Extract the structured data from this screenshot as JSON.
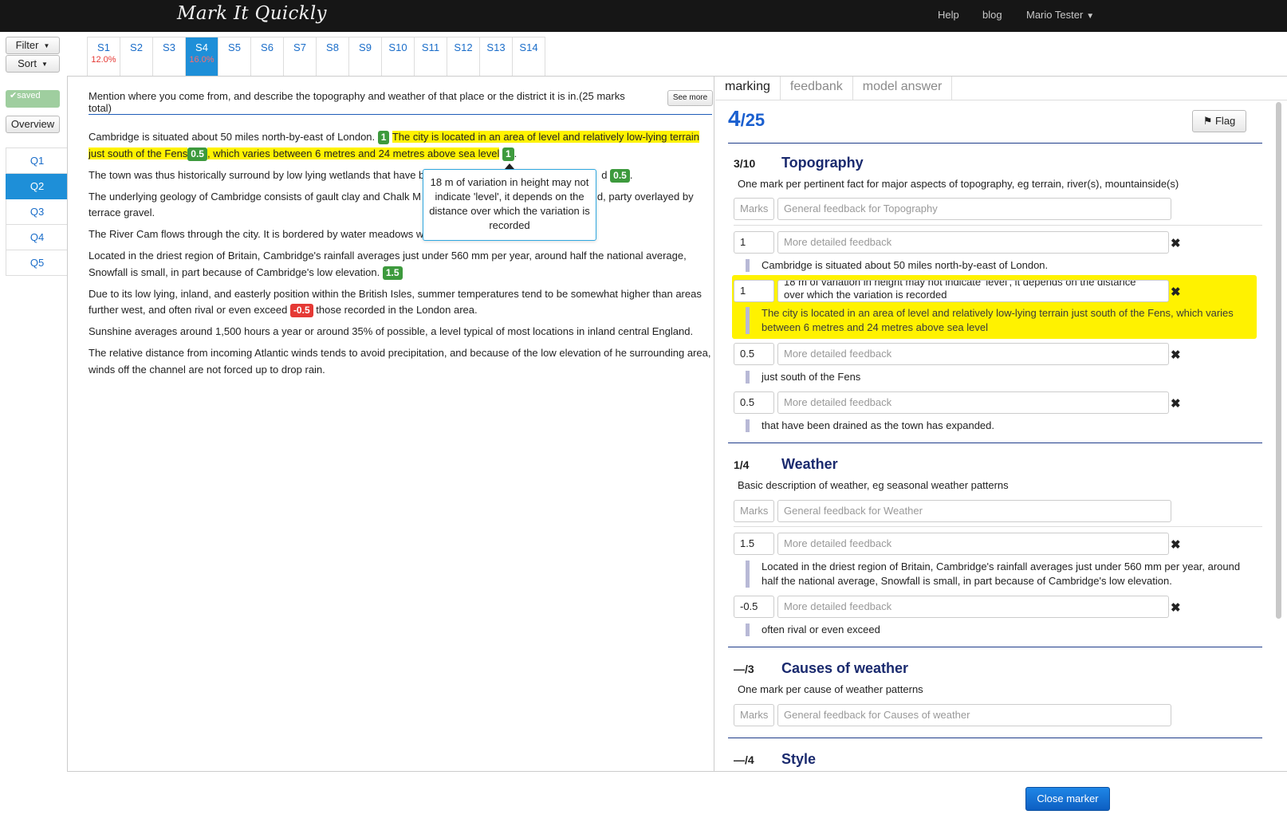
{
  "navbar": {
    "brand": "Mark It Quickly",
    "help": "Help",
    "blog": "blog",
    "user": "Mario Tester"
  },
  "controls": {
    "filter": "Filter",
    "sort": "Sort",
    "saved": "saved",
    "overview": "Overview"
  },
  "questions": [
    "Q1",
    "Q2",
    "Q3",
    "Q4",
    "Q5"
  ],
  "students": [
    {
      "label": "S1",
      "pct": "12.0%"
    },
    {
      "label": "S2",
      "pct": ""
    },
    {
      "label": "S3",
      "pct": ""
    },
    {
      "label": "S4",
      "pct": "16.0%"
    },
    {
      "label": "S5",
      "pct": ""
    },
    {
      "label": "S6",
      "pct": ""
    },
    {
      "label": "S7",
      "pct": ""
    },
    {
      "label": "S8",
      "pct": ""
    },
    {
      "label": "S9",
      "pct": ""
    },
    {
      "label": "S10",
      "pct": ""
    },
    {
      "label": "S11",
      "pct": ""
    },
    {
      "label": "S12",
      "pct": ""
    },
    {
      "label": "S13",
      "pct": ""
    },
    {
      "label": "S14",
      "pct": ""
    }
  ],
  "question": {
    "text": "Mention where you come from, and describe the topography and weather of that place or the district it is in.(25 marks total)",
    "see_more": "See more"
  },
  "answer": {
    "p1a": "Cambridge is situated about 50 miles north-by-east of London.",
    "m1": "1",
    "p1b": "The city is located in an area of level and relatively low-lying terrain just south of the Fens",
    "m2": "0.5",
    "p1c": ", which varies between 6 metres and 24 metres above sea level",
    "m3": "1",
    "p2a": "The town was thus historically surround by low lying wetlands that have b",
    "p2b": "d",
    "m4": "0.5",
    "p3a": "The underlying geology of Cambridge consists of gault clay and Chalk M",
    "p3b": "sand, party overlayed by terrace gravel.",
    "p4": "The River Cam flows through the city. It is bordered by water meadows w",
    "p5": "Located in the driest region of Britain, Cambridge's rainfall averages just under 560 mm per year, around half the national average, Snowfall is small, in part because of Cambridge's low elevation.",
    "m5": "1.5",
    "p6a": "Due to its low lying, inland, and easterly position within the British Isles, summer temperatures tend to be somewhat higher than areas further west, and often rival or even exceed",
    "m6": "-0.5",
    "p6b": "those recorded in the London area.",
    "p7": "Sunshine averages around 1,500 hours a year or around 35% of possible, a level typical of most locations in inland central England.",
    "p8": "The relative distance from incoming Atlantic winds tends to avoid precipitation, and because of the low elevation of he surrounding area, winds off the channel are not forced up to drop rain.",
    "tooltip": "18 m of variation in height may not indicate 'level', it depends on the distance over which the variation is recorded"
  },
  "right_tabs": [
    "marking",
    "feedbank",
    "model answer"
  ],
  "score": {
    "value": "4",
    "total": "/25"
  },
  "flag": "Flag",
  "sections": {
    "topography": {
      "score": "3/10",
      "title": "Topography",
      "desc": "One mark per pertinent fact for major aspects of topography, eg terrain, river(s), mountainside(s)",
      "marks_placeholder": "Marks",
      "general_placeholder": "General feedback for Topography",
      "items": [
        {
          "mark": "1",
          "feedback_placeholder": "More detailed feedback",
          "quote": "Cambridge is situated about 50 miles north-by-east of London."
        },
        {
          "mark": "1",
          "feedback_line1": "18 m of variation in height may not indicate 'level', it depends on the distance",
          "feedback_line2": "over which the variation is recorded",
          "quote": "The city is located in an area of level and relatively low-lying terrain just south of the Fens, which varies between 6 metres and 24 metres above sea level"
        },
        {
          "mark": "0.5",
          "feedback_placeholder": "More detailed feedback",
          "quote": "just south of the Fens"
        },
        {
          "mark": "0.5",
          "feedback_placeholder": "More detailed feedback",
          "quote": "that have been drained as the town has expanded."
        }
      ]
    },
    "weather": {
      "score": "1/4",
      "title": "Weather",
      "desc": "Basic description of weather, eg seasonal weather patterns",
      "marks_placeholder": "Marks",
      "general_placeholder": "General feedback for Weather",
      "items": [
        {
          "mark": "1.5",
          "feedback_placeholder": "More detailed feedback",
          "quote": "Located in the driest region of Britain, Cambridge's rainfall averages just under 560 mm per year, around half the national average, Snowfall is small, in part because of Cambridge's low elevation."
        },
        {
          "mark": "-0.5",
          "feedback_placeholder": "More detailed feedback",
          "quote": "often rival or even exceed"
        }
      ]
    },
    "causes": {
      "score": "—/3",
      "title": "Causes of weather",
      "desc": "One mark per cause of weather patterns",
      "marks_placeholder": "Marks",
      "general_placeholder": "General feedback for Causes of weather"
    },
    "style": {
      "score": "—/4",
      "title": "Style"
    }
  },
  "close_marker": "Close marker"
}
